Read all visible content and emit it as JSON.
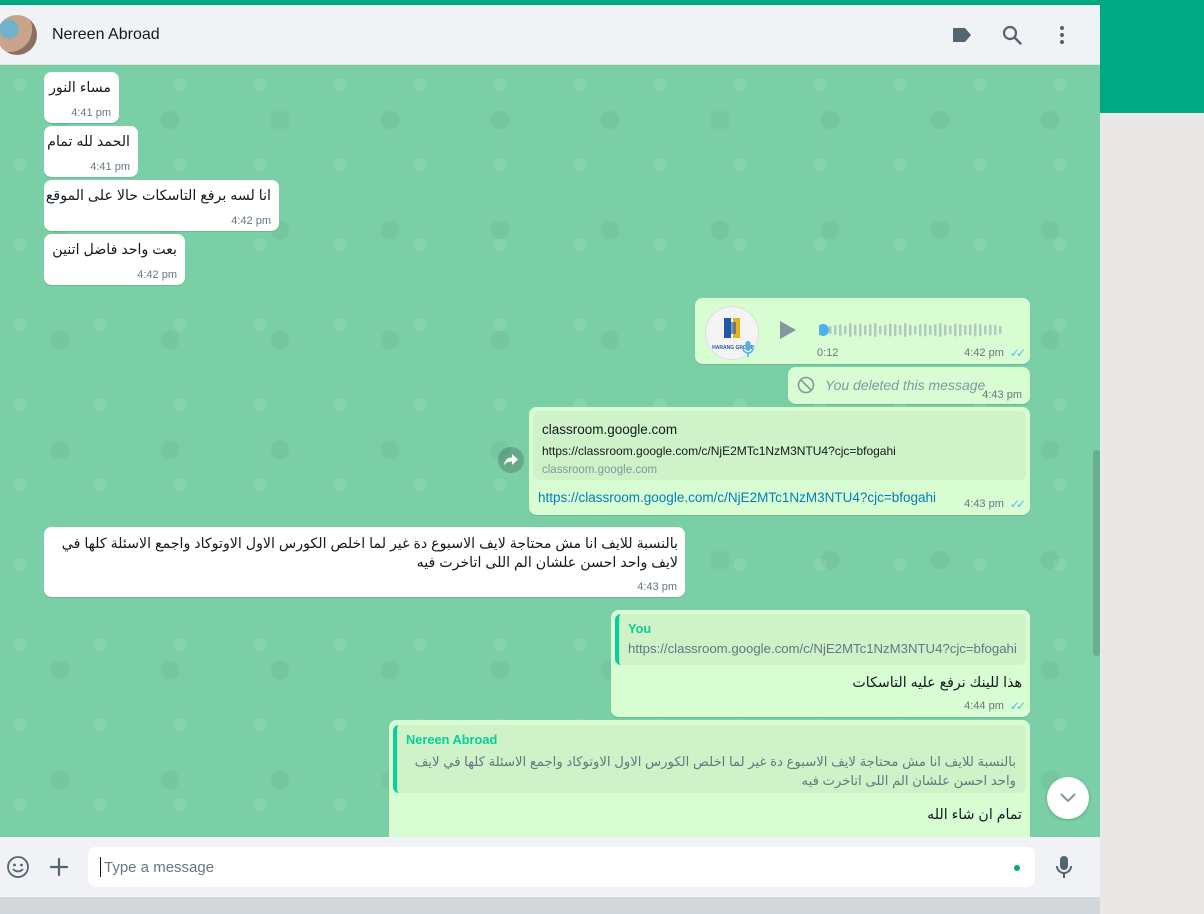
{
  "header": {
    "contact_name": "Nereen Abroad"
  },
  "messages": {
    "m1": {
      "text": "مساء النور",
      "time": "4:41 pm"
    },
    "m2": {
      "text": "الحمد لله تمام",
      "time": "4:41 pm"
    },
    "m3": {
      "text": "انا لسه برفع التاسكات حالا على الموقع",
      "time": "4:42 pm"
    },
    "m4": {
      "text": "بعت واحد فاضل اتنين",
      "time": "4:42 pm"
    },
    "voice": {
      "duration": "0:12",
      "time": "4:42 pm",
      "logo_text": "HARANG GROUP",
      "progress": 0.0
    },
    "deleted": {
      "text": "You deleted this message",
      "time": "4:43 pm"
    },
    "link": {
      "preview_title": "classroom.google.com",
      "preview_url": "https://classroom.google.com/c/NjE2MTc1NzM3NTU4?cjc=bfogahi",
      "preview_domain": "classroom.google.com",
      "link_text": "https://classroom.google.com/c/NjE2MTc1NzM3NTU4?cjc=bfogahi",
      "time": "4:43 pm"
    },
    "m5": {
      "text": "بالنسبة للايف انا مش محتاجة لايف الاسبوع دة غير لما اخلص الكورس الاول الاوتوكاد واجمع الاسئلة كلها في لايف واحد احسن علشان الم اللى اتاخرت فيه",
      "time": "4:43 pm"
    },
    "reply1": {
      "quote_name": "You",
      "quote_text": "https://classroom.google.com/c/NjE2MTc1NzM3NTU4?cjc=bfogahi",
      "text": "هذا للينك نرفع عليه التاسكات",
      "time": "4:44 pm"
    },
    "reply2": {
      "quote_name": "Nereen Abroad",
      "quote_text": "بالنسبة للايف انا مش محتاجة لايف الاسبوع دة غير لما اخلص الكورس الاول الاوتوكاد واجمع الاسئلة كلها في لايف واحد احسن علشان الم اللى اتاخرت فيه",
      "text": "تمام ان شاء الله"
    }
  },
  "footer": {
    "placeholder": "Type a message"
  },
  "icons": [
    "label-icon",
    "search-icon",
    "menu-icon",
    "emoji-icon",
    "attach-icon",
    "mic-icon",
    "forward-icon",
    "play-icon",
    "deleted-icon",
    "chevron-down-icon"
  ],
  "colors": {
    "accent": "#00a884",
    "incoming": "#ffffff",
    "outgoing": "#d9fdd3",
    "ticks": "#53bdeb"
  }
}
